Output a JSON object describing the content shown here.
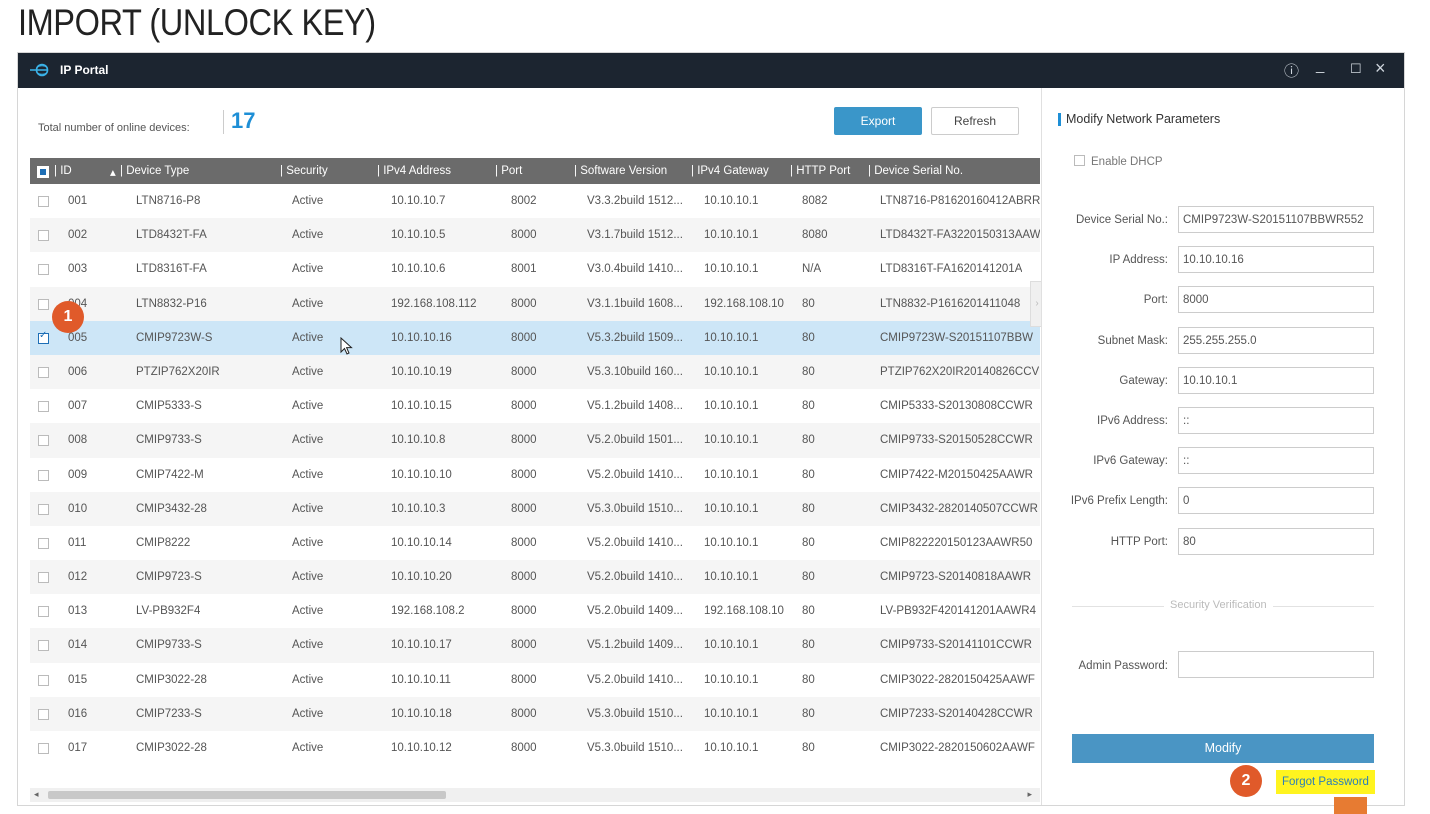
{
  "heading": "IMPORT (UNLOCK KEY)",
  "window": {
    "title": "IP Portal",
    "controls": {
      "info": "ⓘ",
      "minimize": "_",
      "maximize": "☐",
      "close": "×"
    }
  },
  "summary": {
    "label": "Total number of online devices:",
    "count": "17"
  },
  "toolbar": {
    "export": "Export",
    "refresh": "Refresh"
  },
  "columns": [
    "ID",
    "Device Type",
    "Security",
    "IPv4 Address",
    "Port",
    "Software Version",
    "IPv4 Gateway",
    "HTTP Port",
    "Device Serial No."
  ],
  "rows": [
    {
      "id": "001",
      "type": "LTN8716-P8",
      "security": "Active",
      "ip": "10.10.10.7",
      "port": "8002",
      "sw": "V3.3.2build 1512...",
      "gw": "10.10.10.1",
      "http": "8082",
      "serial": "LTN8716-P81620160412ABRR"
    },
    {
      "id": "002",
      "type": "LTD8432T-FA",
      "security": "Active",
      "ip": "10.10.10.5",
      "port": "8000",
      "sw": "V3.1.7build 1512...",
      "gw": "10.10.10.1",
      "http": "8080",
      "serial": "LTD8432T-FA3220150313AAW"
    },
    {
      "id": "003",
      "type": "LTD8316T-FA",
      "security": "Active",
      "ip": "10.10.10.6",
      "port": "8001",
      "sw": "V3.0.4build 1410...",
      "gw": "10.10.10.1",
      "http": "N/A",
      "serial": "LTD8316T-FA1620141201A"
    },
    {
      "id": "004",
      "type": "LTN8832-P16",
      "security": "Active",
      "ip": "192.168.108.112",
      "port": "8000",
      "sw": "V3.1.1build 1608...",
      "gw": "192.168.108.10",
      "http": "80",
      "serial": "LTN8832-P1616201411048"
    },
    {
      "id": "005",
      "type": "CMIP9723W-S",
      "security": "Active",
      "ip": "10.10.10.16",
      "port": "8000",
      "sw": "V5.3.2build 1509...",
      "gw": "10.10.10.1",
      "http": "80",
      "serial": "CMIP9723W-S20151107BBW"
    },
    {
      "id": "006",
      "type": "PTZIP762X20IR",
      "security": "Active",
      "ip": "10.10.10.19",
      "port": "8000",
      "sw": "V5.3.10build 160...",
      "gw": "10.10.10.1",
      "http": "80",
      "serial": "PTZIP762X20IR20140826CCV"
    },
    {
      "id": "007",
      "type": "CMIP5333-S",
      "security": "Active",
      "ip": "10.10.10.15",
      "port": "8000",
      "sw": "V5.1.2build 1408...",
      "gw": "10.10.10.1",
      "http": "80",
      "serial": "CMIP5333-S20130808CCWR"
    },
    {
      "id": "008",
      "type": "CMIP9733-S",
      "security": "Active",
      "ip": "10.10.10.8",
      "port": "8000",
      "sw": "V5.2.0build 1501...",
      "gw": "10.10.10.1",
      "http": "80",
      "serial": "CMIP9733-S20150528CCWR"
    },
    {
      "id": "009",
      "type": "CMIP7422-M",
      "security": "Active",
      "ip": "10.10.10.10",
      "port": "8000",
      "sw": "V5.2.0build 1410...",
      "gw": "10.10.10.1",
      "http": "80",
      "serial": "CMIP7422-M20150425AAWR"
    },
    {
      "id": "010",
      "type": "CMIP3432-28",
      "security": "Active",
      "ip": "10.10.10.3",
      "port": "8000",
      "sw": "V5.3.0build 1510...",
      "gw": "10.10.10.1",
      "http": "80",
      "serial": "CMIP3432-2820140507CCWR"
    },
    {
      "id": "011",
      "type": "CMIP8222",
      "security": "Active",
      "ip": "10.10.10.14",
      "port": "8000",
      "sw": "V5.2.0build 1410...",
      "gw": "10.10.10.1",
      "http": "80",
      "serial": "CMIP822220150123AAWR50"
    },
    {
      "id": "012",
      "type": "CMIP9723-S",
      "security": "Active",
      "ip": "10.10.10.20",
      "port": "8000",
      "sw": "V5.2.0build 1410...",
      "gw": "10.10.10.1",
      "http": "80",
      "serial": "CMIP9723-S20140818AAWR"
    },
    {
      "id": "013",
      "type": "LV-PB932F4",
      "security": "Active",
      "ip": "192.168.108.2",
      "port": "8000",
      "sw": "V5.2.0build 1409...",
      "gw": "192.168.108.10",
      "http": "80",
      "serial": "LV-PB932F420141201AAWR4"
    },
    {
      "id": "014",
      "type": "CMIP9733-S",
      "security": "Active",
      "ip": "10.10.10.17",
      "port": "8000",
      "sw": "V5.1.2build 1409...",
      "gw": "10.10.10.1",
      "http": "80",
      "serial": "CMIP9733-S20141101CCWR"
    },
    {
      "id": "015",
      "type": "CMIP3022-28",
      "security": "Active",
      "ip": "10.10.10.11",
      "port": "8000",
      "sw": "V5.2.0build 1410...",
      "gw": "10.10.10.1",
      "http": "80",
      "serial": "CMIP3022-2820150425AAWF"
    },
    {
      "id": "016",
      "type": "CMIP7233-S",
      "security": "Active",
      "ip": "10.10.10.18",
      "port": "8000",
      "sw": "V5.3.0build 1510...",
      "gw": "10.10.10.1",
      "http": "80",
      "serial": "CMIP7233-S20140428CCWR"
    },
    {
      "id": "017",
      "type": "CMIP3022-28",
      "security": "Active",
      "ip": "10.10.10.12",
      "port": "8000",
      "sw": "V5.3.0build 1510...",
      "gw": "10.10.10.1",
      "http": "80",
      "serial": "CMIP3022-2820150602AAWF"
    }
  ],
  "selected_row": "005",
  "panel": {
    "title": "Modify Network Parameters",
    "dhcp": "Enable DHCP",
    "fields": [
      {
        "label": "Device Serial No.:",
        "value": "CMIP9723W-S20151107BBWR552"
      },
      {
        "label": "IP Address:",
        "value": "10.10.10.16"
      },
      {
        "label": "Port:",
        "value": "8000"
      },
      {
        "label": "Subnet Mask:",
        "value": "255.255.255.0"
      },
      {
        "label": "Gateway:",
        "value": "10.10.10.1"
      },
      {
        "label": "IPv6 Address:",
        "value": "::"
      },
      {
        "label": "IPv6 Gateway:",
        "value": "::"
      },
      {
        "label": "IPv6 Prefix Length:",
        "value": "0"
      },
      {
        "label": "HTTP Port:",
        "value": "80"
      }
    ],
    "security_verification": "Security Verification",
    "admin_password_label": "Admin Password:",
    "admin_password_value": "",
    "modify": "Modify",
    "forgot_password": "Forgot Password"
  },
  "callouts": [
    "1",
    "2"
  ],
  "colors": {
    "accent": "#1e8fd6",
    "titlebar": "#1c2530",
    "callout": "#e05a2a",
    "highlight": "#fff41f",
    "selected_row": "#cde6f7"
  }
}
